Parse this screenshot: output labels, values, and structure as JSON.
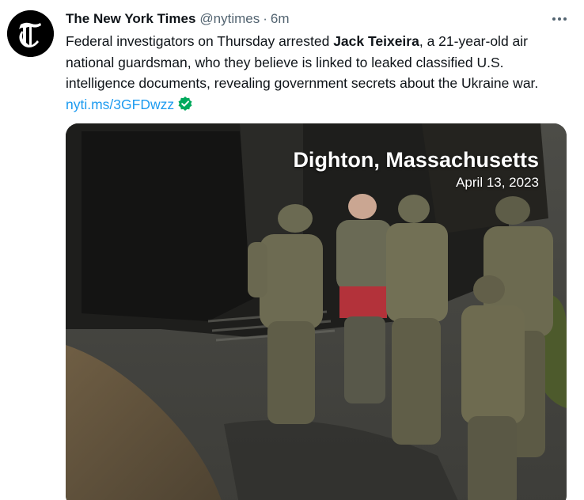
{
  "tweet": {
    "display_name": "The New York Times",
    "handle": "@nytimes",
    "separator": "·",
    "time": "6m",
    "text_before": "Federal investigators on Thursday arrested ",
    "text_bold": "Jack Teixeira",
    "text_after": ", a 21-year-old air national guardsman, who they believe is linked to leaked classified U.S. intelligence documents, revealing government secrets about the Ukraine war. ",
    "link": "nyti.ms/3GFDwzz"
  },
  "media": {
    "location": "Dighton, Massachusetts",
    "date": "April 13, 2023"
  },
  "icons": {
    "avatar": "nyt-t-logo",
    "verified": "verified-badge-icon",
    "more": "more-options-icon"
  },
  "colors": {
    "link": "#1d9bf0",
    "verified": "#00a95c",
    "secondary_text": "#536471"
  }
}
